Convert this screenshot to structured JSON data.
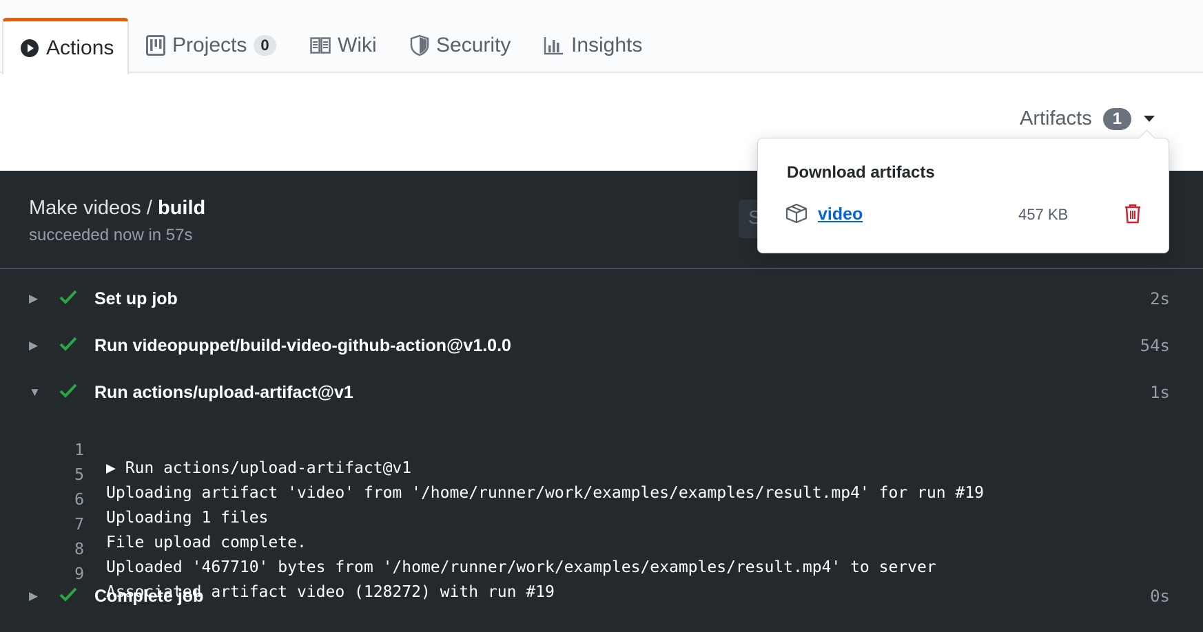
{
  "tabs": [
    {
      "label": "Actions",
      "icon": "play-icon",
      "active": true
    },
    {
      "label": "Projects",
      "icon": "project-icon",
      "count": "0"
    },
    {
      "label": "Wiki",
      "icon": "book-icon"
    },
    {
      "label": "Security",
      "icon": "shield-icon"
    },
    {
      "label": "Insights",
      "icon": "graph-icon"
    }
  ],
  "artifacts": {
    "label": "Artifacts",
    "count": "1",
    "popup_title": "Download artifacts",
    "items": [
      {
        "name": "video",
        "size": "457 KB",
        "icon": "package-icon",
        "delete_icon": "trash-icon"
      }
    ]
  },
  "job": {
    "workflow": "Make videos /",
    "name": "build",
    "status": "succeeded now in 57s",
    "search_partial": "S"
  },
  "steps": [
    {
      "name": "Set up job",
      "duration": "2s",
      "expanded": false
    },
    {
      "name": "Run videopuppet/build-video-github-action@v1.0.0",
      "duration": "54s",
      "expanded": false
    },
    {
      "name": "Run actions/upload-artifact@v1",
      "duration": "1s",
      "expanded": true
    },
    {
      "name": "Complete job",
      "duration": "0s",
      "expanded": false
    }
  ],
  "log_lines": [
    {
      "num": "1",
      "text": "▶ Run actions/upload-artifact@v1"
    },
    {
      "num": "5",
      "text": "Uploading artifact 'video' from '/home/runner/work/examples/examples/result.mp4' for run #19"
    },
    {
      "num": "6",
      "text": "Uploading 1 files"
    },
    {
      "num": "7",
      "text": "File upload complete."
    },
    {
      "num": "8",
      "text": "Uploaded '467710' bytes from '/home/runner/work/examples/examples/result.mp4' to server"
    },
    {
      "num": "9",
      "text": "Associated artifact video (128272) with run #19"
    }
  ],
  "colors": {
    "accent_tab": "#e36209",
    "success": "#28a745",
    "link": "#0366d6",
    "danger": "#cb2431",
    "log_bg": "#24292e"
  }
}
